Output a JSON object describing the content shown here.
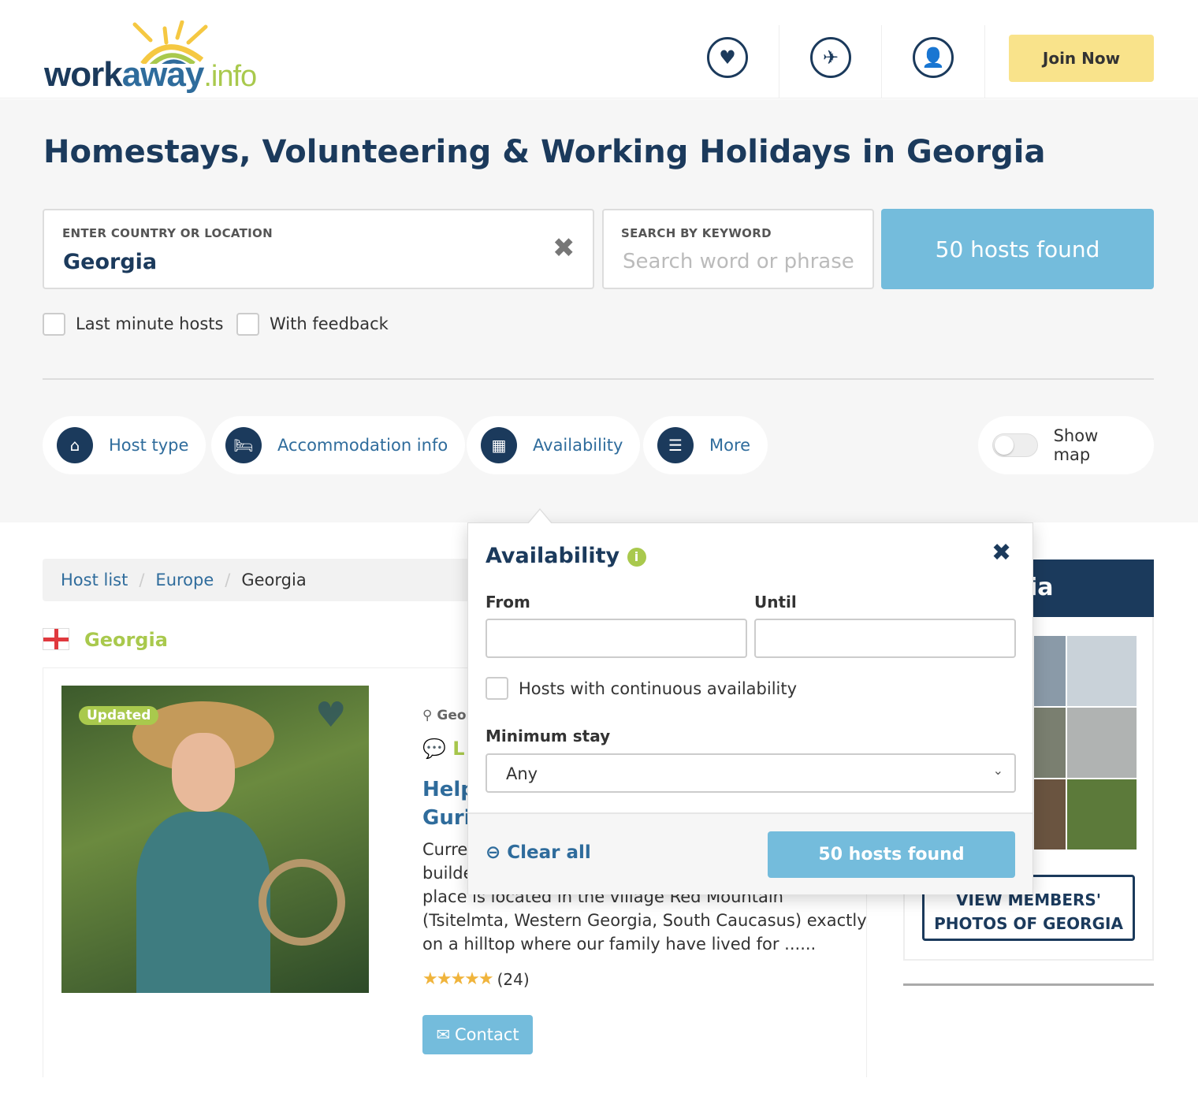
{
  "header": {
    "logo_text_1": "work",
    "logo_text_2": "away",
    "logo_text_3": ".info",
    "icons": [
      "heart-icon",
      "plane-icon",
      "user-icon"
    ],
    "join_label": "Join Now"
  },
  "page": {
    "title": "Homestays, Volunteering & Working Holidays in Georgia"
  },
  "search": {
    "location_label": "ENTER COUNTRY OR LOCATION",
    "location_value": "Georgia",
    "keyword_label": "SEARCH BY KEYWORD",
    "keyword_placeholder": "Search word or phrase",
    "results_label": "50 hosts found"
  },
  "checkboxes": {
    "last_minute": "Last minute hosts",
    "feedback": "With feedback"
  },
  "filters": [
    {
      "label": "Host type",
      "icon": "home-icon"
    },
    {
      "label": "Accommodation info",
      "icon": "bed-icon"
    },
    {
      "label": "Availability",
      "icon": "calendar-icon"
    },
    {
      "label": "More",
      "icon": "sliders-icon"
    }
  ],
  "show_map": {
    "label": "Show map",
    "on": false
  },
  "breadcrumb": [
    "Host list",
    "Europe",
    "Georgia"
  ],
  "country_heading": "Georgia",
  "card": {
    "badge": "Updated",
    "location": "Geor",
    "lang": "L",
    "title_1": "Help",
    "title_2": "Guri",
    "desc_1": "Curre",
    "desc_2": "builde",
    "desc_3": "place is located in the village Red Mountain",
    "desc_4": "(Tsitelmta, Western Georgia, South Caucasus) exactly",
    "desc_5": "on a hilltop where our family have lived for ......",
    "rating": 5,
    "reviews": "(24)",
    "contact": "Contact"
  },
  "sidebar": {
    "title_fragment": "ia",
    "button": "VIEW MEMBERS' PHOTOS OF GEORGIA"
  },
  "popup": {
    "title": "Availability",
    "from": "From",
    "until": "Until",
    "from_value": "",
    "until_value": "",
    "continuous": "Hosts with continuous availability",
    "min_stay": "Minimum stay",
    "min_stay_value": "Any",
    "clear": "Clear all",
    "results": "50 hosts found"
  },
  "colors": {
    "navy": "#1b3a5c",
    "blue": "#74bcdc",
    "green": "#a9c94d",
    "yellow": "#f9e38b"
  }
}
